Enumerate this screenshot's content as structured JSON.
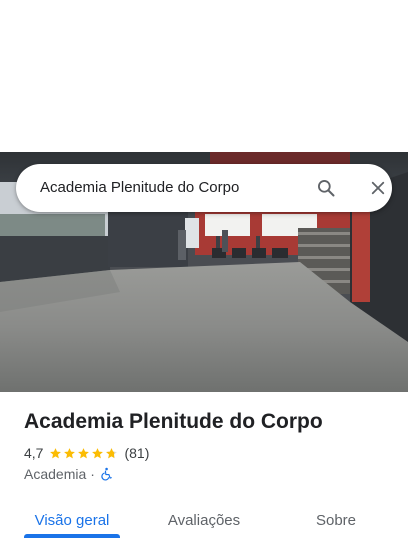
{
  "search": {
    "query": "Academia Plenitude do Corpo",
    "search_icon": "search-icon",
    "close_icon": "close-icon"
  },
  "photo": {
    "subject": "interior-gym-photo"
  },
  "place": {
    "name": "Academia Plenitude do Corpo",
    "rating": "4,7",
    "stars": 4.7,
    "review_count": "(81)",
    "category": "Academia",
    "separator": "·",
    "accessibility_icon": "wheelchair-accessible-icon"
  },
  "tabs": [
    {
      "label": "Visão geral",
      "active": true
    },
    {
      "label": "Avaliações",
      "active": false
    },
    {
      "label": "Sobre",
      "active": false
    }
  ],
  "colors": {
    "accent": "#1a73e8",
    "star": "#fbbc04",
    "accessibility": "#1a73e8"
  }
}
